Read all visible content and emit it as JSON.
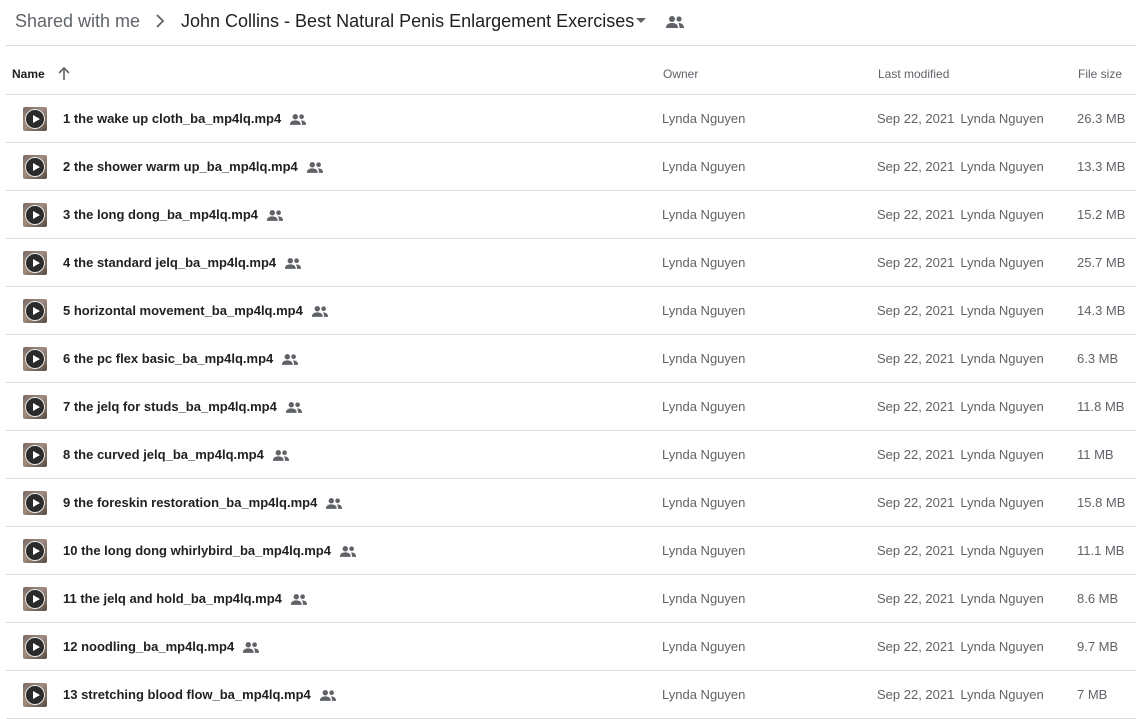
{
  "breadcrumb": {
    "root": "Shared with me",
    "current": "John Collins - Best Natural Penis Enlargement Exercises"
  },
  "columns": {
    "name": "Name",
    "owner": "Owner",
    "last_modified": "Last modified",
    "file_size": "File size"
  },
  "icons": {
    "breadcrumb_separator": "chevron-right-icon",
    "folder_dropdown": "caret-down-icon",
    "folder_shared": "people-icon",
    "sort": "arrow-up-icon",
    "row_shared": "people-icon",
    "file_type": "video-play-icon"
  },
  "colors": {
    "text_primary": "#202124",
    "text_secondary": "#5f6368",
    "divider": "#dadce0"
  },
  "files": [
    {
      "name": "1 the wake up cloth_ba_mp4lq.mp4",
      "owner": "Lynda Nguyen",
      "date": "Sep 22, 2021",
      "modified_by": "Lynda Nguyen",
      "size": "26.3 MB"
    },
    {
      "name": "2 the shower warm up_ba_mp4lq.mp4",
      "owner": "Lynda Nguyen",
      "date": "Sep 22, 2021",
      "modified_by": "Lynda Nguyen",
      "size": "13.3 MB"
    },
    {
      "name": "3 the long dong_ba_mp4lq.mp4",
      "owner": "Lynda Nguyen",
      "date": "Sep 22, 2021",
      "modified_by": "Lynda Nguyen",
      "size": "15.2 MB"
    },
    {
      "name": "4 the standard jelq_ba_mp4lq.mp4",
      "owner": "Lynda Nguyen",
      "date": "Sep 22, 2021",
      "modified_by": "Lynda Nguyen",
      "size": "25.7 MB"
    },
    {
      "name": "5 horizontal movement_ba_mp4lq.mp4",
      "owner": "Lynda Nguyen",
      "date": "Sep 22, 2021",
      "modified_by": "Lynda Nguyen",
      "size": "14.3 MB"
    },
    {
      "name": "6 the pc flex basic_ba_mp4lq.mp4",
      "owner": "Lynda Nguyen",
      "date": "Sep 22, 2021",
      "modified_by": "Lynda Nguyen",
      "size": "6.3 MB"
    },
    {
      "name": "7 the jelq for studs_ba_mp4lq.mp4",
      "owner": "Lynda Nguyen",
      "date": "Sep 22, 2021",
      "modified_by": "Lynda Nguyen",
      "size": "11.8 MB"
    },
    {
      "name": "8 the curved jelq_ba_mp4lq.mp4",
      "owner": "Lynda Nguyen",
      "date": "Sep 22, 2021",
      "modified_by": "Lynda Nguyen",
      "size": "11 MB"
    },
    {
      "name": "9 the foreskin restoration_ba_mp4lq.mp4",
      "owner": "Lynda Nguyen",
      "date": "Sep 22, 2021",
      "modified_by": "Lynda Nguyen",
      "size": "15.8 MB"
    },
    {
      "name": "10 the long dong whirlybird_ba_mp4lq.mp4",
      "owner": "Lynda Nguyen",
      "date": "Sep 22, 2021",
      "modified_by": "Lynda Nguyen",
      "size": "11.1 MB"
    },
    {
      "name": "11 the jelq and hold_ba_mp4lq.mp4",
      "owner": "Lynda Nguyen",
      "date": "Sep 22, 2021",
      "modified_by": "Lynda Nguyen",
      "size": "8.6 MB"
    },
    {
      "name": "12 noodling_ba_mp4lq.mp4",
      "owner": "Lynda Nguyen",
      "date": "Sep 22, 2021",
      "modified_by": "Lynda Nguyen",
      "size": "9.7 MB"
    },
    {
      "name": "13 stretching blood flow_ba_mp4lq.mp4",
      "owner": "Lynda Nguyen",
      "date": "Sep 22, 2021",
      "modified_by": "Lynda Nguyen",
      "size": "7 MB"
    }
  ]
}
